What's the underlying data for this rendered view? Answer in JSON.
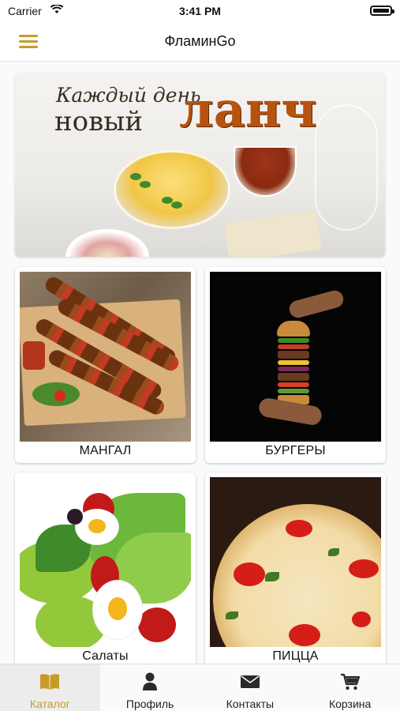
{
  "status_bar": {
    "carrier": "Carrier",
    "time": "3:41 PM"
  },
  "nav": {
    "title": "ФламинGo",
    "menu_icon": "hamburger-menu-icon"
  },
  "banner": {
    "line1": "Каждый день",
    "line2": "новый",
    "line3": "ланч"
  },
  "categories": [
    {
      "label": "МАНГАЛ"
    },
    {
      "label": "БУРГЕРЫ"
    },
    {
      "label": "Салаты"
    },
    {
      "label": "ПИЦЦА"
    }
  ],
  "tabs": [
    {
      "label": "Каталог",
      "icon": "book-icon",
      "active": true
    },
    {
      "label": "Профиль",
      "icon": "person-icon"
    },
    {
      "label": "Контакты",
      "icon": "envelope-icon"
    },
    {
      "label": "Корзина",
      "icon": "cart-icon"
    }
  ],
  "colors": {
    "accent": "#c89a28",
    "lunch_text": "#b8530f"
  }
}
